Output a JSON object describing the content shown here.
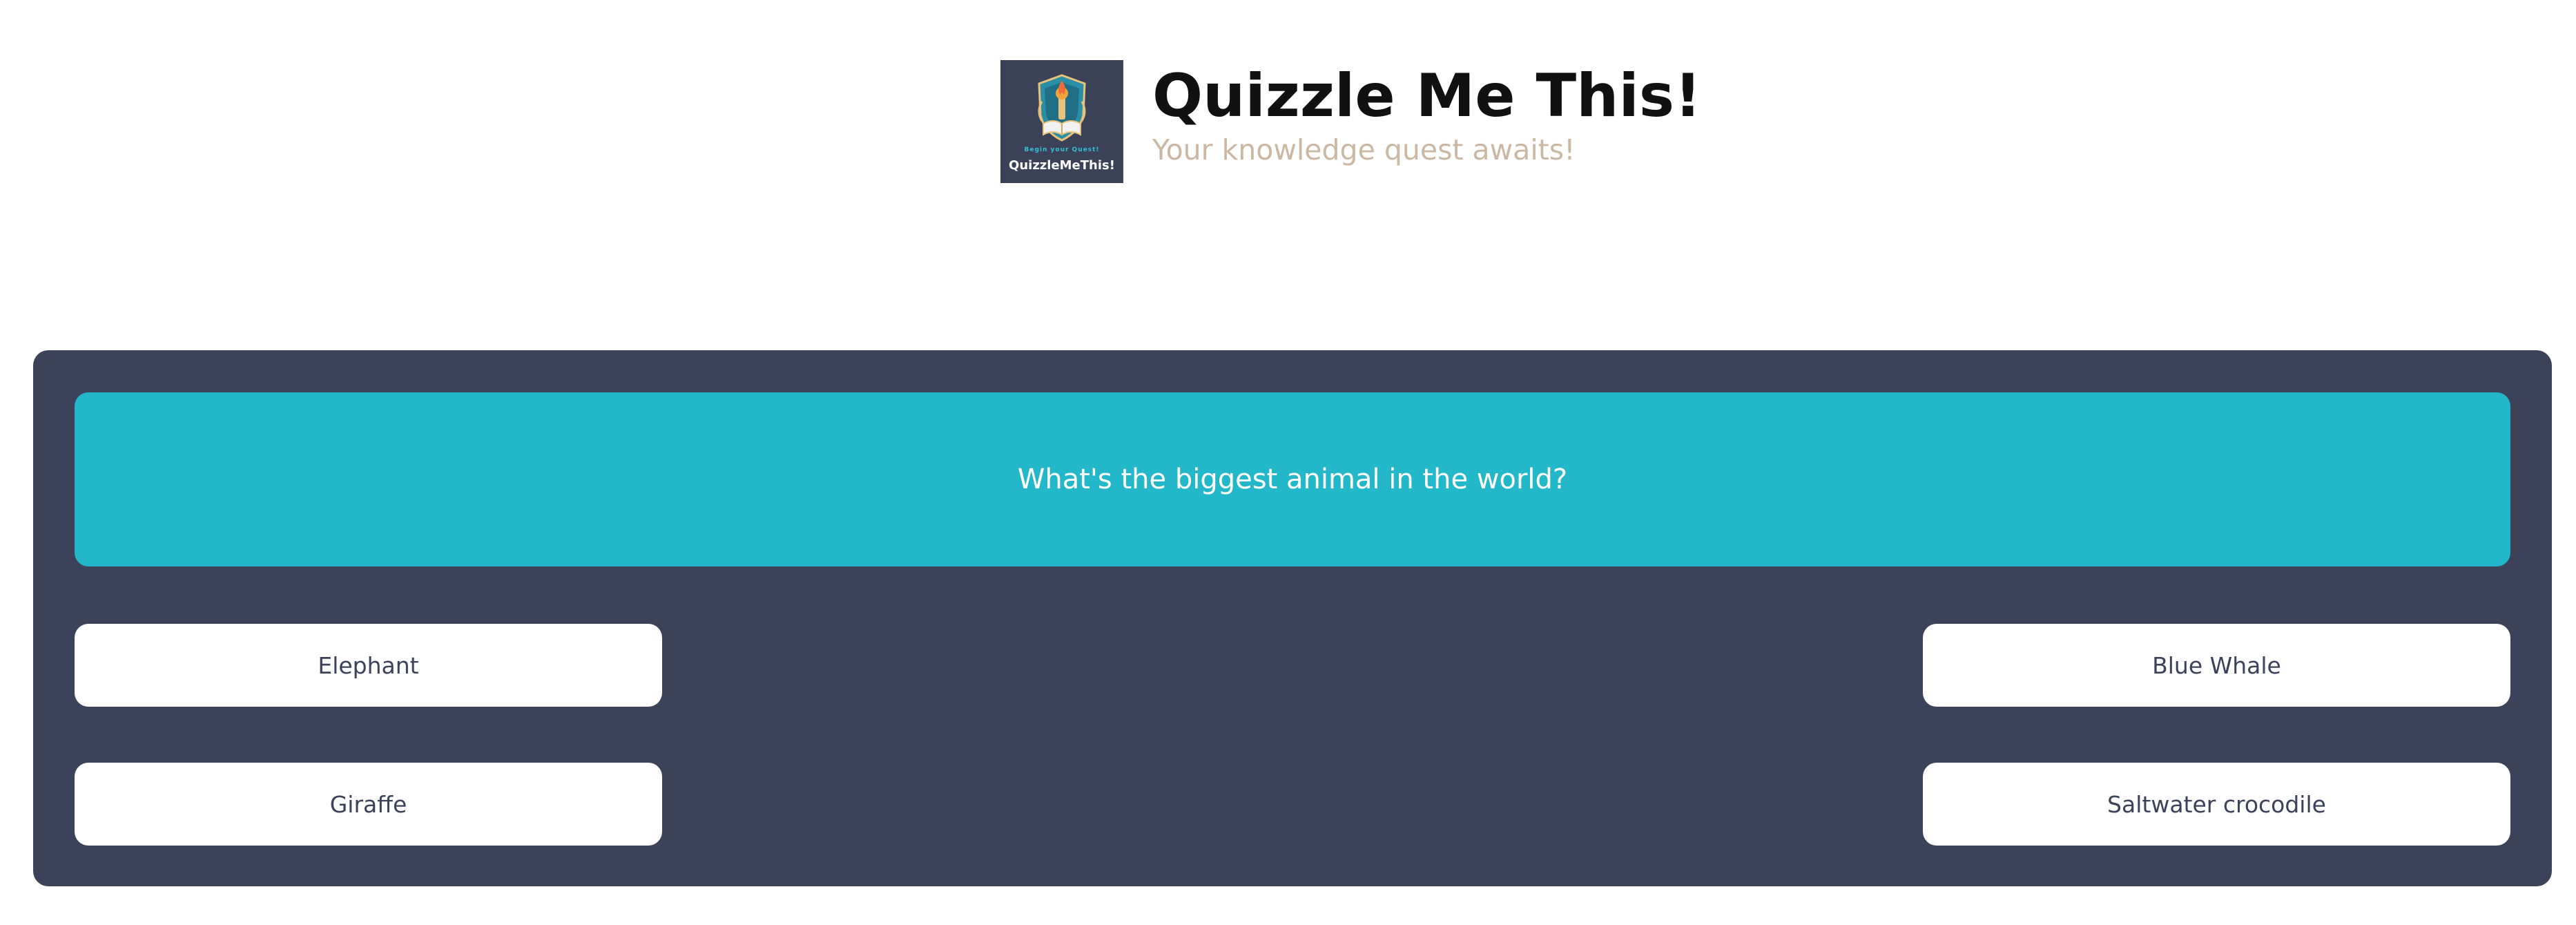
{
  "header": {
    "logo": {
      "icon": "quest-crest-icon",
      "tagline": "Begin your Quest!",
      "name": "QuizzleMeThis!"
    },
    "title": "Quizzle Me This!",
    "subtitle": "Your knowledge quest awaits!"
  },
  "quiz": {
    "question": "What's the biggest animal in the world?",
    "answers": [
      {
        "label": "Elephant"
      },
      {
        "label": "Blue Whale"
      },
      {
        "label": "Giraffe"
      },
      {
        "label": "Saltwater crocodile"
      }
    ]
  },
  "colors": {
    "panel": "#3b4259",
    "question_bg": "#23b8c9",
    "answer_bg": "#ffffff",
    "subtitle": "#cbb8a2"
  }
}
